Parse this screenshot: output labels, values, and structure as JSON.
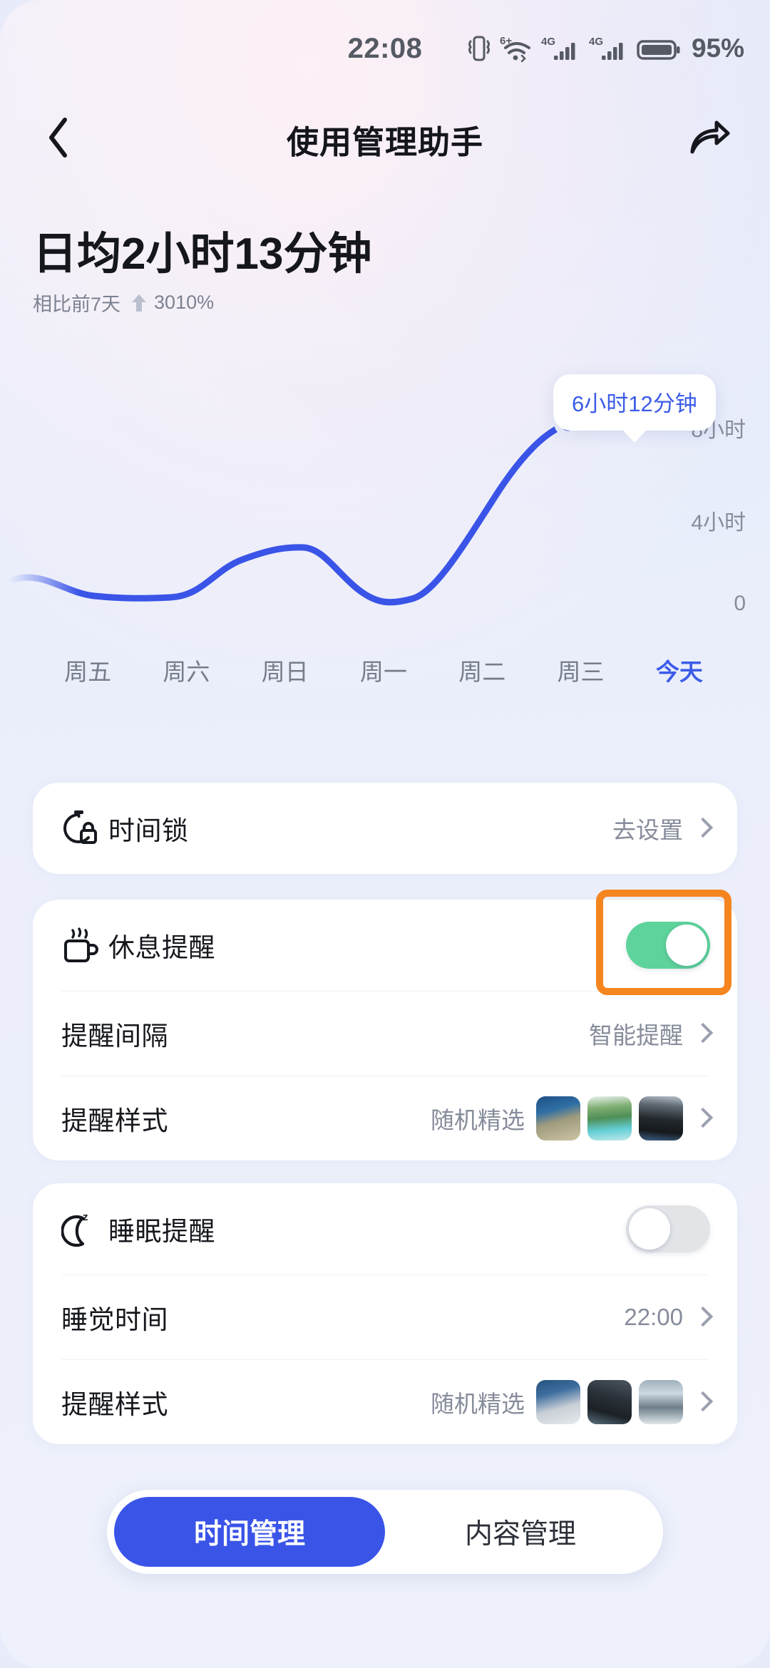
{
  "statusbar": {
    "time": "22:08",
    "battery_percent": "95%",
    "icons": [
      "vibrate-icon",
      "wifi-6-plus-icon",
      "signal-4g-icon",
      "signal-4g-icon-2",
      "battery-icon"
    ],
    "wifi_badge": "6+",
    "network_label": "4G"
  },
  "navbar": {
    "title": "使用管理助手",
    "back_icon": "chevron-left-icon",
    "share_icon": "share-arrow-icon"
  },
  "summary": {
    "headline": "日均2小时13分钟",
    "compare_prefix": "相比前7天",
    "compare_value": "3010%",
    "trend": "up"
  },
  "chart_data": {
    "type": "line",
    "title": "",
    "xlabel": "",
    "ylabel": "",
    "categories": [
      "周五",
      "周六",
      "周日",
      "周一",
      "周二",
      "周三",
      "今天"
    ],
    "values": [
      1.35,
      0.85,
      1.35,
      2.1,
      0.9,
      2.3,
      6.2
    ],
    "value_labels": [
      "",
      "",
      "",
      "",
      "",
      "",
      "6小时12分钟"
    ],
    "ytick_labels": [
      "8小时",
      "4小时",
      "0"
    ],
    "ytick_values": [
      8,
      4,
      0
    ],
    "ylim": [
      0,
      8
    ],
    "grid": false,
    "legend": "none",
    "highlight_index": 6,
    "highlight_label": "6小时12分钟",
    "line_color": "#3a54e8",
    "active_tick": "今天"
  },
  "cards": {
    "time_lock": {
      "icon": "stopwatch-lock-icon",
      "label": "时间锁",
      "value": "去设置",
      "chevron": "chevron-right-icon"
    },
    "break_reminder": {
      "icon": "coffee-cup-icon",
      "label": "休息提醒",
      "toggle": "on",
      "toggle_color": "#5ed39b",
      "highlight_color": "#f5851f",
      "rows": [
        {
          "label": "提醒间隔",
          "value": "智能提醒",
          "chevron": "chevron-right-icon"
        },
        {
          "label": "提醒样式",
          "value": "随机精选",
          "chevron": "chevron-right-icon",
          "thumbs": 3
        }
      ]
    },
    "sleep_reminder": {
      "icon": "moon-sleep-icon",
      "label": "睡眠提醒",
      "toggle": "off",
      "rows": [
        {
          "label": "睡觉时间",
          "value": "22:00",
          "chevron": "chevron-right-icon"
        },
        {
          "label": "提醒样式",
          "value": "随机精选",
          "chevron": "chevron-right-icon",
          "thumbs": 3
        }
      ]
    }
  },
  "tabbar": {
    "tabs": [
      {
        "label": "时间管理",
        "active": true
      },
      {
        "label": "内容管理",
        "active": false
      }
    ],
    "active_color": "#3a54e8"
  }
}
